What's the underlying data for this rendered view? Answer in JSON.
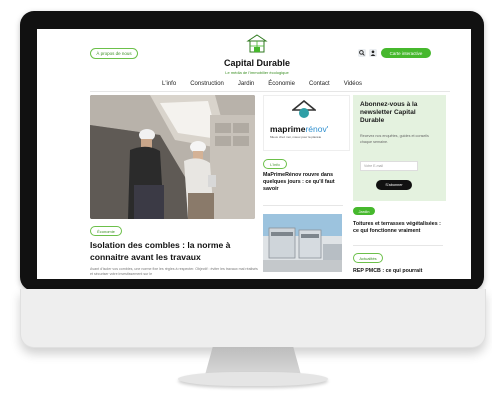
{
  "header": {
    "about_label": "À propos de nous",
    "search_icon": "search-icon",
    "account_icon": "user-icon",
    "map_label": "Carte interactive",
    "site_title": "Capital Durable",
    "tagline": "Le média de l'immobilier écologique"
  },
  "nav": {
    "items": [
      "L'info",
      "Construction",
      "Jardin",
      "Économie",
      "Contact",
      "Vidéos"
    ]
  },
  "featured": {
    "tag": "Économie",
    "title": "Isolation des combles : la norme à connaitre avant les travaux",
    "excerpt": "Avant d'isoler vos combles, une norme fixe les règles à respecter. Objectif : éviter les travaux mal réalisés et sécuriser votre investissement sur le"
  },
  "middle": {
    "logo_main": "maprime",
    "logo_accent": "rénov'",
    "logo_sub": "Mieux chez moi, mieux pour la planète",
    "tag": "L'info",
    "title": "MaPrimeRénov rouvre dans quelques jours : ce qu'il faut savoir"
  },
  "newsletter": {
    "title": "Abonnez-vous à la newsletter Capital Durable",
    "text": "Recevez nos enquêtes, guides et conseils chaque semaine.",
    "email_placeholder": "Votre E-mail",
    "button": "S'abonner"
  },
  "sidebar": {
    "tag1": "Jardin",
    "title1": "Toitures et terrasses végétalisées : ce qui fonctionne vraiment",
    "tag2": "Actualités",
    "title2": "REP PMCB : ce qui pourrait"
  },
  "colors": {
    "brand_green": "#46b82d",
    "accent_blue": "#2f8fcf"
  }
}
